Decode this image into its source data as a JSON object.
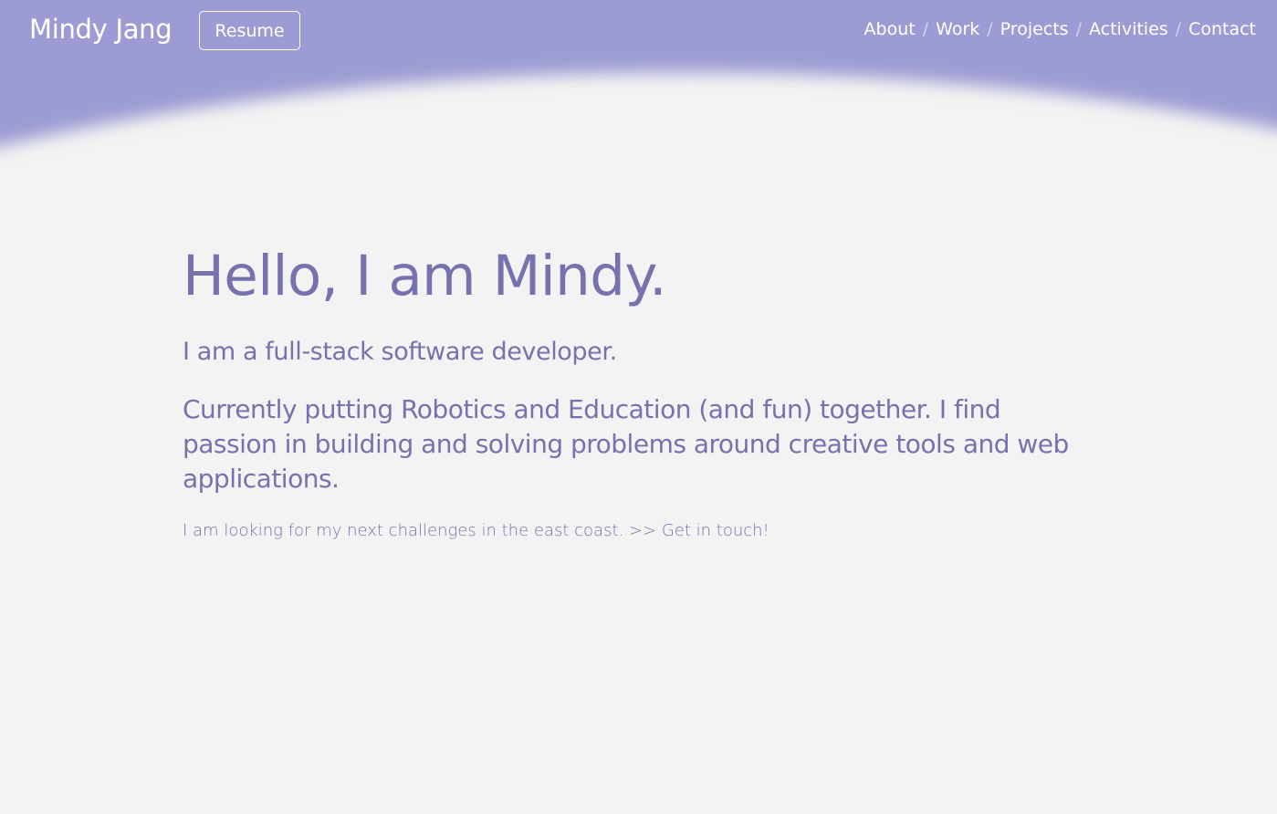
{
  "colors": {
    "header_background": "#9c9bd3",
    "page_background": "#f3f3f3",
    "text_accent": "#7672ae",
    "header_text": "#ffffff"
  },
  "header": {
    "brand": "Mindy Jang",
    "resume_label": "Resume",
    "nav": [
      {
        "label": "About"
      },
      {
        "label": "Work"
      },
      {
        "label": "Projects"
      },
      {
        "label": "Activities"
      },
      {
        "label": "Contact"
      }
    ],
    "separator": "/"
  },
  "hero": {
    "title": "Hello, I am Mindy.",
    "subtitle": "I am a full-stack software developer.",
    "description": "Currently putting Robotics and Education (and fun) together. I find passion in building and solving problems around creative tools and web applications.",
    "note_text": "I am looking for my next challenges in the east coast. ",
    "note_link": ">> Get in touch!"
  }
}
